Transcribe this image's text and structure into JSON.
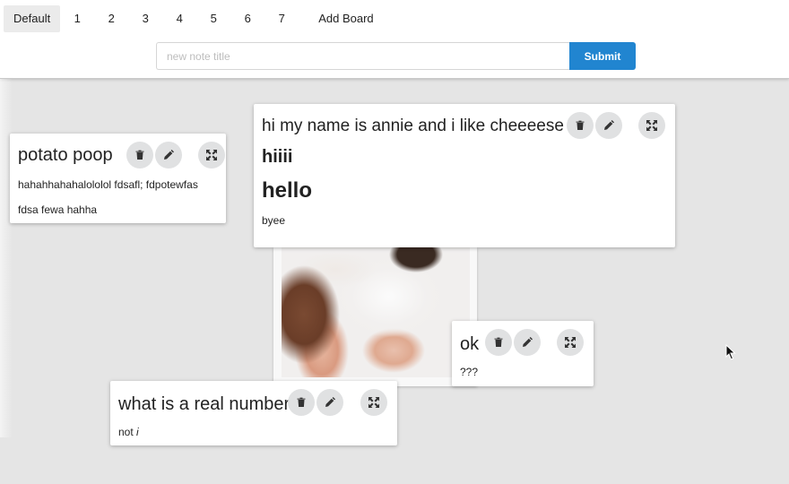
{
  "tabs": [
    {
      "label": "Default",
      "active": true
    },
    {
      "label": "1"
    },
    {
      "label": "2"
    },
    {
      "label": "3"
    },
    {
      "label": "4"
    },
    {
      "label": "5"
    },
    {
      "label": "6"
    },
    {
      "label": "7"
    },
    {
      "label": "Add Board"
    }
  ],
  "form": {
    "placeholder": "new note title",
    "value": "",
    "submit_label": "Submit"
  },
  "colors": {
    "accent": "#2185d0",
    "board_bg": "#e5e5e5",
    "icon_button_bg": "#e0e1e2"
  },
  "note_icons": [
    "trash-icon",
    "pencil-icon",
    "expand-icon"
  ],
  "notes": {
    "potato": {
      "title": "potato poop",
      "lines": [
        "hahahhahahalololol fdsafl; fdpotewfas",
        "fdsa fewa hahha"
      ]
    },
    "annie": {
      "title": "hi my name is annie and i like cheeeese",
      "heading_small": "hiiii",
      "heading_large": "hello",
      "text": "byee"
    },
    "ok": {
      "title": "ok",
      "text": "???"
    },
    "real": {
      "title": "what is a real number",
      "text": "not",
      "text_italic": "i"
    }
  },
  "image_note": {
    "alt": "kitten photo"
  }
}
